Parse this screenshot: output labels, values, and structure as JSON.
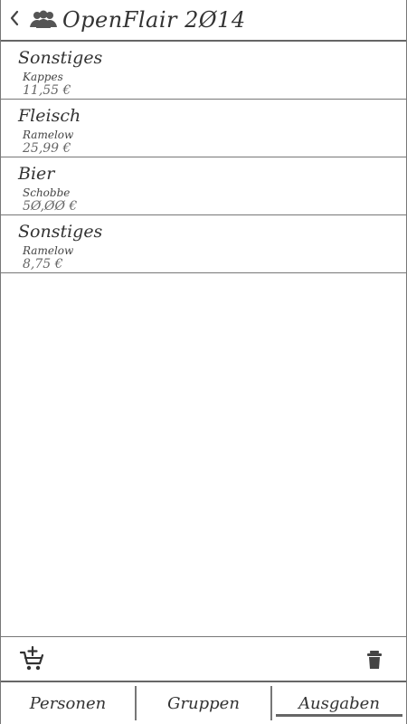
{
  "header": {
    "title": "OpenFlair 2Ø14",
    "back_icon": "chevron-left-icon",
    "app_icon": "group-users-icon"
  },
  "expenses": [
    {
      "category": "Sonstiges",
      "person": "Kappes",
      "amount": "11,55 €"
    },
    {
      "category": "Fleisch",
      "person": "Ramelow",
      "amount": "25,99 €"
    },
    {
      "category": "Bier",
      "person": "Schobbe",
      "amount": "5Ø,ØØ €"
    },
    {
      "category": "Sonstiges",
      "person": "Ramelow",
      "amount": "8,75 €"
    }
  ],
  "toolbar": {
    "add_icon": "add-to-cart-icon",
    "delete_icon": "trash-icon"
  },
  "tabs": [
    {
      "label": "Personen",
      "active": false
    },
    {
      "label": "Gruppen",
      "active": false
    },
    {
      "label": "Ausgaben",
      "active": true
    }
  ],
  "colors": {
    "line": "#777777",
    "text": "#333333",
    "muted": "#666666"
  }
}
